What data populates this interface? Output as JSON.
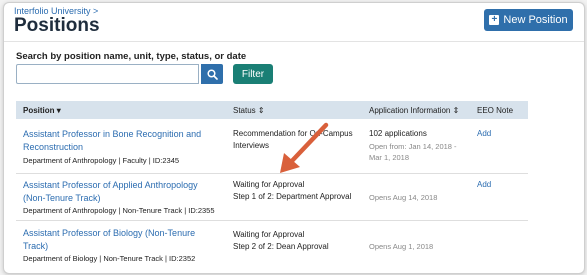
{
  "header": {
    "breadcrumb": "Interfolio University >",
    "title": "Positions",
    "new_button": "New Position"
  },
  "search": {
    "label": "Search by position name, unit, type, status, or date",
    "value": "",
    "placeholder": "",
    "filter_label": "Filter"
  },
  "table": {
    "columns": {
      "position": "Position",
      "position_sort": "▾",
      "status": "Status",
      "status_sort": "⇕",
      "app_info": "Application Information",
      "app_info_sort": "⇕",
      "eeo": "EEO Note"
    },
    "rows": [
      {
        "title_line1": "Assistant Professor in Bone Recognition and",
        "title_line2": "Reconstruction",
        "meta": "Department of Anthropology  |  Faculty  |  ID:2345",
        "status_line1": "Recommendation for On-Campus",
        "status_line2": "Interviews",
        "app_count": "102 applications",
        "app_dates_line1": "Open from: Jan 14, 2018 -",
        "app_dates_line2": "Mar 1, 2018",
        "eeo": "Add"
      },
      {
        "title_line1": "Assistant Professor of Applied Anthropology",
        "title_line2": "(Non-Tenure Track)",
        "meta": "Department of Anthropology | Non-Tenure Track | ID:2355",
        "status_line1": "Waiting for Approval",
        "status_line2": "Step 1 of 2: Department Approval",
        "app_dates": "Opens Aug 14, 2018",
        "eeo": "Add"
      },
      {
        "title_line1": "Assistant Professor of Biology (Non-Tenure",
        "title_line2": "Track)",
        "meta": "Department of Biology | Non-Tenure Track | ID:2352",
        "status_line1": "Waiting for Approval",
        "status_line2": "Step 2 of 2: Dean Approval",
        "app_dates": "Opens Aug 1, 2018"
      }
    ]
  },
  "colors": {
    "primary": "#2f6fab",
    "filter": "#1a7f75",
    "arrow": "#d9603b",
    "header_bg": "#d7e2ec"
  },
  "icons": {
    "new": "plus-square-icon",
    "search": "search-icon",
    "sort": "sort-icon",
    "annotation": "annotation-arrow-icon"
  }
}
